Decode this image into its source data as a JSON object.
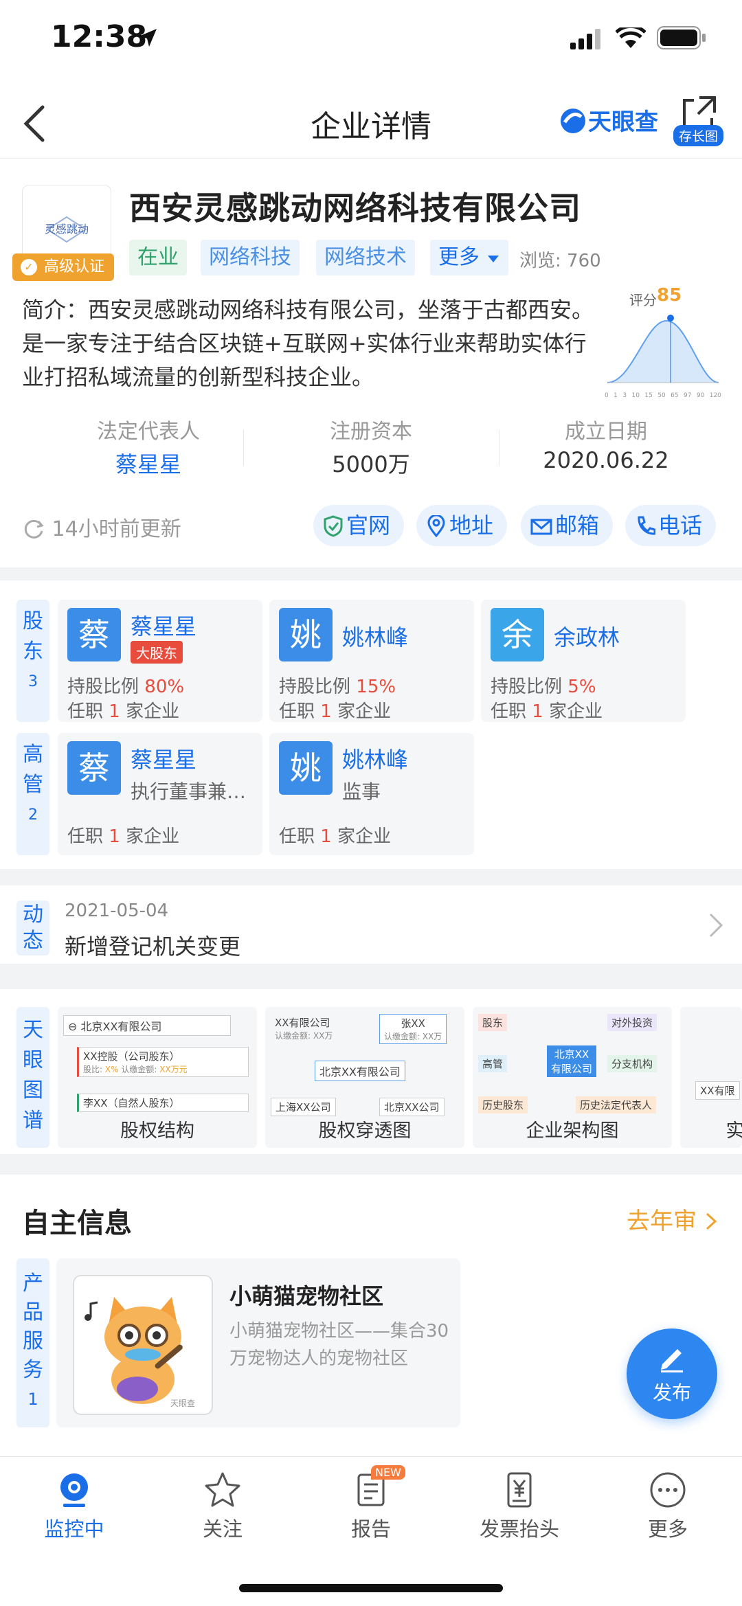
{
  "status": {
    "time": "12:38"
  },
  "nav": {
    "title": "企业详情",
    "brand": "天眼查",
    "longshot": "存长图"
  },
  "company": {
    "logo_text": "灵感跳动",
    "cert": "高级认证",
    "name": "西安灵感跳动网络科技有限公司",
    "tags": [
      "在业",
      "网络科技",
      "网络技术",
      "更多"
    ],
    "views": "浏览: 760",
    "intro": "简介：西安灵感跳动网络科技有限公司，坐落于古都西安。是一家专注于结合区块链+互联网+实体行业来帮助实体行业打招私域流量的创新型科技企业。",
    "score_label": "评分",
    "score_value": "85",
    "score_ticks": [
      "0",
      "1",
      "3",
      "10",
      "15",
      "50",
      "65",
      "97",
      "90",
      "120"
    ],
    "stats": [
      {
        "label": "法定代表人",
        "value": "蔡星星"
      },
      {
        "label": "注册资本",
        "value": "5000万"
      },
      {
        "label": "成立日期",
        "value": "2020.06.22"
      }
    ],
    "updated": "14小时前更新",
    "actions": [
      "官网",
      "地址",
      "邮箱",
      "电话"
    ]
  },
  "shareholders": {
    "tab": [
      "股",
      "东",
      "3"
    ],
    "items": [
      {
        "avatar": "蔡",
        "name": "蔡星星",
        "badge": "大股东",
        "ratio_label": "持股比例",
        "ratio": "80%",
        "jobs_prefix": "任职",
        "jobs": "1",
        "jobs_suffix": "家企业"
      },
      {
        "avatar": "姚",
        "name": "姚林峰",
        "ratio_label": "持股比例",
        "ratio": "15%",
        "jobs_prefix": "任职",
        "jobs": "1",
        "jobs_suffix": "家企业"
      },
      {
        "avatar": "余",
        "name": "余政林",
        "ratio_label": "持股比例",
        "ratio": "5%",
        "jobs_prefix": "任职",
        "jobs": "1",
        "jobs_suffix": "家企业"
      }
    ]
  },
  "executives": {
    "tab": [
      "高",
      "管",
      "2"
    ],
    "items": [
      {
        "avatar": "蔡",
        "name": "蔡星星",
        "role": "执行董事兼总经理",
        "jobs_prefix": "任职",
        "jobs": "1",
        "jobs_suffix": "家企业"
      },
      {
        "avatar": "姚",
        "name": "姚林峰",
        "role": "监事",
        "jobs_prefix": "任职",
        "jobs": "1",
        "jobs_suffix": "家企业"
      }
    ]
  },
  "dynamic": {
    "tab": [
      "动",
      "态"
    ],
    "date": "2021-05-04",
    "text": "新增登记机关变更"
  },
  "graphs": {
    "tab": [
      "天",
      "眼",
      "图",
      "谱"
    ],
    "cards": [
      {
        "title": "股权结构",
        "n1": "北京XX有限公司",
        "n2": "XX控股（公司股东）",
        "n2_sub_ratio": "股比:",
        "n2_ratio": "X%",
        "n2_sub_amt": "认缴金额:",
        "n2_amt": "XX万元",
        "n3": "李XX（自然人股东）"
      },
      {
        "title": "股权穿透图",
        "n1": "XX有限公司",
        "n1_sub": "认缴金额: XX万",
        "n2": "张XX",
        "n2_sub": "认缴金额: XX万",
        "center": "北京XX有限公司",
        "n3": "上海XX公司",
        "n4": "北京XX公司"
      },
      {
        "title": "企业架构图",
        "a": "股东",
        "b": "对外投资",
        "c": "高管",
        "center": "北京XX有限公司",
        "d": "分支机构",
        "e": "历史股东",
        "f": "历史法定代表人"
      },
      {
        "title": "实",
        "n1": "XX有限"
      }
    ]
  },
  "self_info": {
    "title": "自主信息",
    "link": "去年审",
    "tab": [
      "产",
      "品",
      "服",
      "务",
      "1"
    ],
    "product": {
      "name": "小萌猫宠物社区",
      "desc": "小萌猫宠物社区——集合30万宠物达人的宠物社区",
      "img_label": "天眼查"
    }
  },
  "fab": {
    "label": "发布"
  },
  "tabbar": {
    "items": [
      "监控中",
      "关注",
      "报告",
      "发票抬头",
      "更多"
    ],
    "new_badge": "NEW"
  },
  "colors": {
    "accent": "#1a6fe8",
    "orange": "#f0a22e",
    "red": "#e84c3d",
    "green": "#2fa36b"
  }
}
